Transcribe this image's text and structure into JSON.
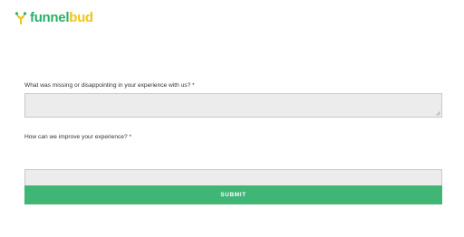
{
  "brand": {
    "name_part_a": "funnel",
    "name_part_b": "bud",
    "primary_color": "#27b06a",
    "secondary_color": "#f0c419"
  },
  "form": {
    "questions": [
      {
        "label": "What was missing or disappointing in your experience with us? *",
        "value": ""
      },
      {
        "label": "How can we improve your experience? *",
        "value": ""
      }
    ],
    "submit_label": "SUBMIT",
    "submit_color": "#3fb576",
    "field_background": "#ececec"
  },
  "icons": {
    "logo": "funnelbud-logo-mark",
    "resize": "resize-handle-icon"
  }
}
